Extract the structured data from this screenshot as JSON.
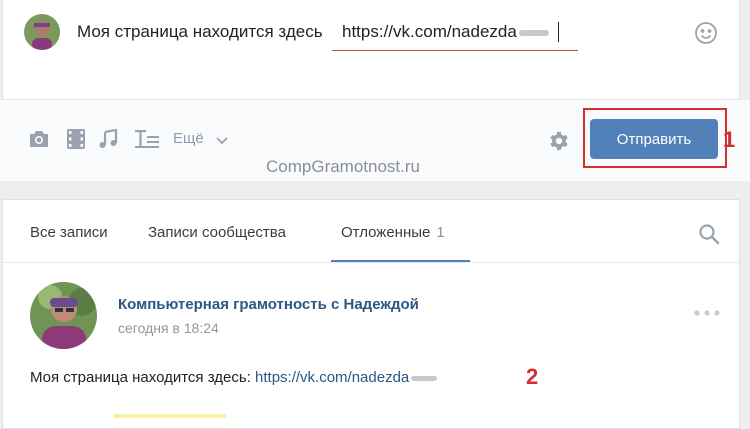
{
  "composer": {
    "message_text": "Моя страница находится здесь",
    "message_url": "https://vk.com/nadezda",
    "emoji_icon": "smile-icon"
  },
  "toolbar": {
    "icons": [
      "camera-icon",
      "video-icon",
      "music-icon",
      "text-format-icon"
    ],
    "more_label": "Ещё",
    "watermark": "CompGramotnost.ru",
    "settings_icon": "gear-icon",
    "send_label": "Отправить",
    "annotation_1": "1"
  },
  "tabs": {
    "items": [
      {
        "label": "Все записи"
      },
      {
        "label": "Записи сообщества"
      },
      {
        "label": "Отложенные",
        "count": "1",
        "active": true
      }
    ],
    "search_icon": "search-icon"
  },
  "post": {
    "author": "Компьютерная грамотность с Надеждой",
    "time": "сегодня в 18:24",
    "text_prefix": "Моя страница находится здесь:",
    "link": "https://vk.com/nadezda",
    "annotation_2": "2",
    "menu_icon": "more-dots-icon"
  },
  "colors": {
    "accent": "#5181b8",
    "link": "#2a5885",
    "annotation_red": "#d32f2f",
    "icon_gray": "#99a2ad"
  }
}
